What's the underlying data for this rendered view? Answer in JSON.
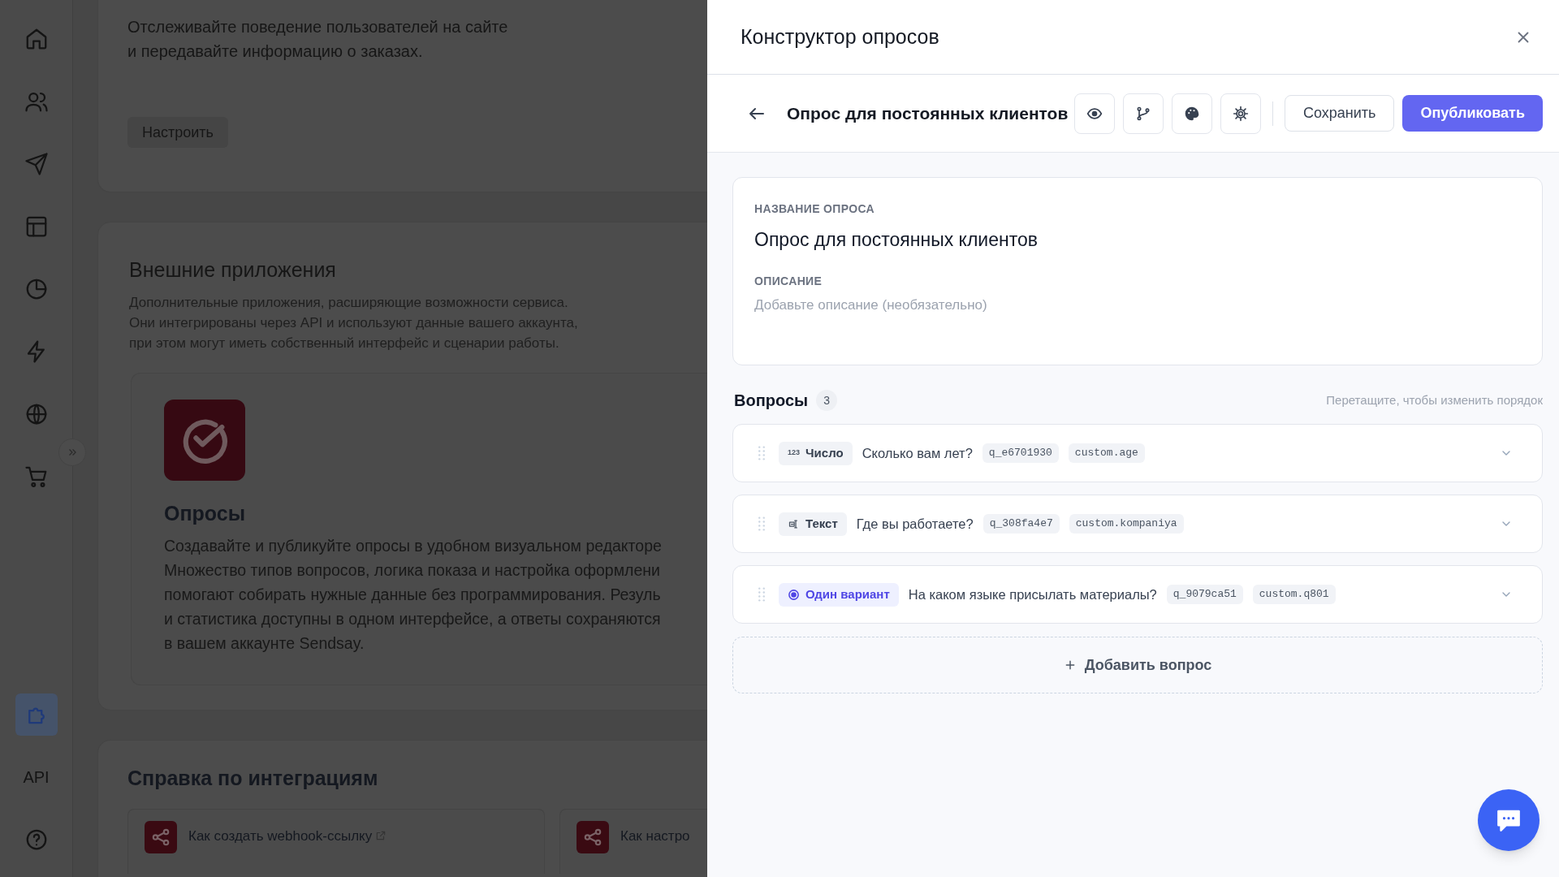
{
  "sidebar": {
    "items": [
      {
        "selected": false
      },
      {
        "selected": false
      },
      {
        "selected": false
      },
      {
        "selected": false
      },
      {
        "selected": false
      },
      {
        "selected": false
      },
      {
        "selected": false
      },
      {
        "selected": false
      }
    ],
    "bottom_items": [
      {
        "kind": "icon",
        "selected": true
      },
      {
        "kind": "text",
        "label": "API",
        "selected": false
      },
      {
        "kind": "icon",
        "selected": false
      }
    ]
  },
  "background": {
    "tracking_card": {
      "description_lines": [
        "Отслеживайте поведение пользователей на сайте",
        "и передавайте информацию о заказах."
      ],
      "button": "Настроить"
    },
    "external_apps": {
      "title": "Внешние приложения",
      "description_lines": [
        "Дополнительные приложения, расширяющие возможности сервиса.",
        "Они интегрированы через API и используют данные вашего аккаунта,",
        "при этом могут иметь собственный интерфейс и сценарии работы."
      ],
      "app": {
        "title": "Опросы",
        "description_lines": [
          "Создавайте и публикуйте опросы в удобном визуальном редакторе",
          "Множество типов вопросов, логика показа и настройка оформлени",
          "помогают собирать нужные данные без программирования. Резуль",
          "и статистика доступны в одном интерфейсе, а ответы сохраняются",
          "в вашем аккаунте Sendsay."
        ]
      }
    },
    "help": {
      "title": "Справка по интеграциям",
      "links": [
        {
          "label": "Как создать webhook-ссылку",
          "external": true
        },
        {
          "label": "Как настро",
          "external": false
        }
      ]
    }
  },
  "panel": {
    "title": "Конструктор опросов",
    "toolbar": {
      "survey_title": "Опрос для постоянных клиентов",
      "save": "Сохранить",
      "publish": "Опубликовать"
    },
    "survey": {
      "name_label": "НАЗВАНИЕ ОПРОСА",
      "name": "Опрос для постоянных клиентов",
      "description_label": "ОПИСАНИЕ",
      "description_placeholder": "Добавьте описание (необязательно)"
    },
    "questions": {
      "title": "Вопросы",
      "count": "3",
      "hint": "Перетащите, чтобы изменить порядок",
      "items": [
        {
          "kind": "number",
          "icon_text": "123",
          "type_label": "Число",
          "text": "Сколько вам лет?",
          "id": "q_e6701930",
          "field": "custom.age"
        },
        {
          "kind": "text",
          "type_label": "Текст",
          "text": "Где вы работаете?",
          "id": "q_308fa4e7",
          "field": "custom.kompaniya"
        },
        {
          "kind": "single_choice",
          "type_label": "Один вариант",
          "text": "На каком языке присылать материалы?",
          "id": "q_9079ca51",
          "field": "custom.q801"
        }
      ],
      "add": "Добавить вопрос"
    }
  }
}
